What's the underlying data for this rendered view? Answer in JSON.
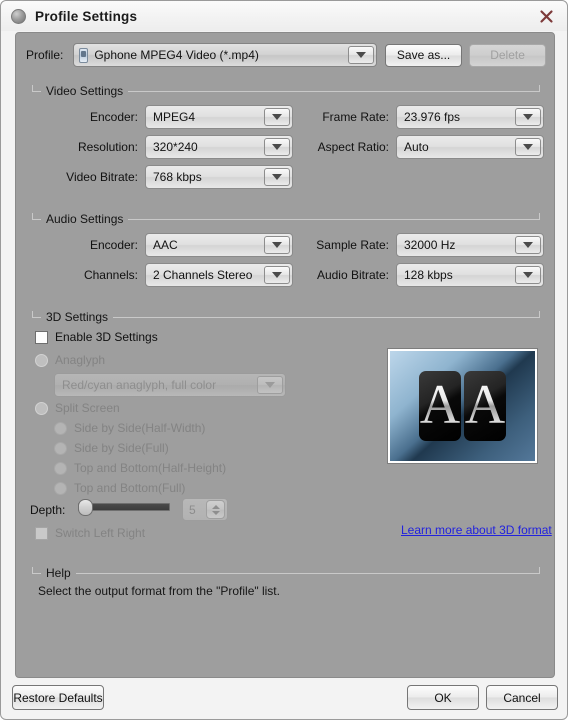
{
  "window": {
    "title": "Profile Settings",
    "icon": "sphere-icon",
    "close_label": "✕"
  },
  "profile": {
    "label": "Profile:",
    "value": "Gphone MPEG4 Video (*.mp4)",
    "device_icon": "phone-icon",
    "save_as_label": "Save as...",
    "delete_label": "Delete"
  },
  "video_settings": {
    "title": "Video Settings",
    "fields": [
      {
        "label": "Encoder:",
        "value": "MPEG4"
      },
      {
        "label": "Resolution:",
        "value": "320*240"
      },
      {
        "label": "Video Bitrate:",
        "value": "768 kbps"
      },
      {
        "label": "Frame Rate:",
        "value": "23.976 fps"
      },
      {
        "label": "Aspect Ratio:",
        "value": "Auto"
      }
    ]
  },
  "audio_settings": {
    "title": "Audio Settings",
    "fields": [
      {
        "label": "Encoder:",
        "value": "AAC"
      },
      {
        "label": "Channels:",
        "value": "2 Channels Stereo"
      },
      {
        "label": "Sample Rate:",
        "value": "32000 Hz"
      },
      {
        "label": "Audio Bitrate:",
        "value": "128 kbps"
      }
    ]
  },
  "three_d_settings": {
    "title": "3D Settings",
    "enable_label": "Enable 3D Settings",
    "anaglyph_label": "Anaglyph",
    "anaglyph_value": "Red/cyan anaglyph, full color",
    "split_screen_label": "Split Screen",
    "split_options": [
      "Side by Side(Half-Width)",
      "Side by Side(Full)",
      "Top and Bottom(Half-Height)",
      "Top and Bottom(Full)"
    ],
    "depth_label": "Depth:",
    "depth_value": "5",
    "switch_left_right_label": "Switch Left Right",
    "learn_more_label": "Learn more about 3D format",
    "preview_letters": [
      "A",
      "A"
    ]
  },
  "help": {
    "title": "Help",
    "text": "Select the output format from the \"Profile\" list."
  },
  "footer": {
    "restore_label": "Restore Defaults",
    "ok_label": "OK",
    "cancel_label": "Cancel"
  },
  "colors": {
    "panel": "#9e9e9e",
    "frame": "#f3f3f3",
    "link": "#2222dd"
  }
}
